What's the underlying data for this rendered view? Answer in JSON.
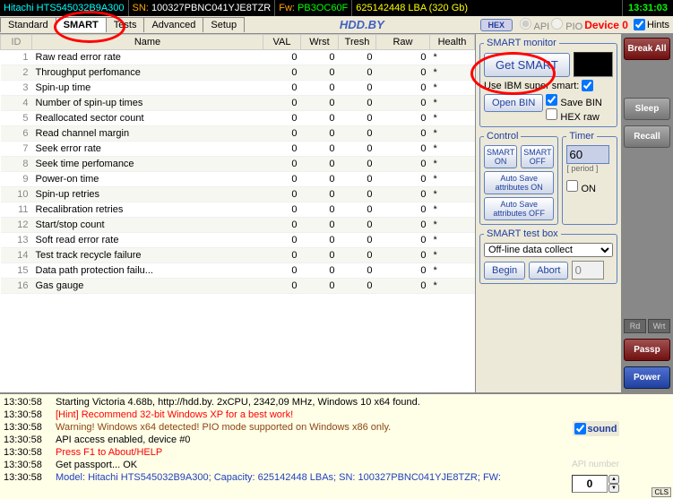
{
  "top": {
    "drive": "Hitachi HTS545032B9A300",
    "sn_label": "SN:",
    "sn_value": "100327PBNC041YJE8TZR",
    "fw_label": "Fw:",
    "fw_value": "PB3OC60F",
    "lba": "625142448 LBA (320 Gb)",
    "clock": "13:31:03"
  },
  "tabs": [
    "Standard",
    "SMART",
    "Tests",
    "Advanced",
    "Setup"
  ],
  "active_tab": "SMART",
  "hddby": "HDD.BY",
  "hex": "HEX",
  "api": "API",
  "pio": "PIO",
  "device": "Device 0",
  "hints": "Hints",
  "table": {
    "headers": [
      "ID",
      "Name",
      "VAL",
      "Wrst",
      "Tresh",
      "Raw",
      "Health"
    ],
    "rows": [
      {
        "id": 1,
        "name": "Raw read error rate",
        "val": 0,
        "wrst": 0,
        "tresh": 0,
        "raw": 0,
        "health": "*"
      },
      {
        "id": 2,
        "name": "Throughput perfomance",
        "val": 0,
        "wrst": 0,
        "tresh": 0,
        "raw": 0,
        "health": "*"
      },
      {
        "id": 3,
        "name": "Spin-up time",
        "val": 0,
        "wrst": 0,
        "tresh": 0,
        "raw": 0,
        "health": "*"
      },
      {
        "id": 4,
        "name": "Number of spin-up times",
        "val": 0,
        "wrst": 0,
        "tresh": 0,
        "raw": 0,
        "health": "*"
      },
      {
        "id": 5,
        "name": "Reallocated sector count",
        "val": 0,
        "wrst": 0,
        "tresh": 0,
        "raw": 0,
        "health": "*"
      },
      {
        "id": 6,
        "name": "Read channel margin",
        "val": 0,
        "wrst": 0,
        "tresh": 0,
        "raw": 0,
        "health": "*"
      },
      {
        "id": 7,
        "name": "Seek error rate",
        "val": 0,
        "wrst": 0,
        "tresh": 0,
        "raw": 0,
        "health": "*"
      },
      {
        "id": 8,
        "name": "Seek time perfomance",
        "val": 0,
        "wrst": 0,
        "tresh": 0,
        "raw": 0,
        "health": "*"
      },
      {
        "id": 9,
        "name": "Power-on time",
        "val": 0,
        "wrst": 0,
        "tresh": 0,
        "raw": 0,
        "health": "*"
      },
      {
        "id": 10,
        "name": "Spin-up retries",
        "val": 0,
        "wrst": 0,
        "tresh": 0,
        "raw": 0,
        "health": "*"
      },
      {
        "id": 11,
        "name": "Recalibration retries",
        "val": 0,
        "wrst": 0,
        "tresh": 0,
        "raw": 0,
        "health": "*"
      },
      {
        "id": 12,
        "name": "Start/stop count",
        "val": 0,
        "wrst": 0,
        "tresh": 0,
        "raw": 0,
        "health": "*"
      },
      {
        "id": 13,
        "name": "Soft read error rate",
        "val": 0,
        "wrst": 0,
        "tresh": 0,
        "raw": 0,
        "health": "*"
      },
      {
        "id": 14,
        "name": "Test track recycle failure",
        "val": 0,
        "wrst": 0,
        "tresh": 0,
        "raw": 0,
        "health": "*"
      },
      {
        "id": 15,
        "name": "Data path protection failu...",
        "val": 0,
        "wrst": 0,
        "tresh": 0,
        "raw": 0,
        "health": "*"
      },
      {
        "id": 16,
        "name": "Gas gauge",
        "val": 0,
        "wrst": 0,
        "tresh": 0,
        "raw": 0,
        "health": "*"
      }
    ]
  },
  "monitor": {
    "legend": "SMART monitor",
    "get_smart": "Get SMART",
    "ibm": "Use IBM super smart:",
    "open_bin": "Open BIN",
    "save_bin": "Save BIN",
    "hex_raw": "HEX raw"
  },
  "control": {
    "legend": "Control",
    "on": "SMART ON",
    "off": "SMART OFF",
    "auto_on": "Auto Save attributes ON",
    "auto_off": "Auto Save attributes OFF"
  },
  "timer": {
    "legend": "Timer",
    "value": "60",
    "period": "[ period ]",
    "on": "ON"
  },
  "testbox": {
    "legend": "SMART test box",
    "selected": "Off-line data collect",
    "begin": "Begin",
    "abort": "Abort",
    "val": "0"
  },
  "side": {
    "break": "Break All",
    "sleep": "Sleep",
    "recall": "Recall",
    "rd": "Rd",
    "wrt": "Wrt",
    "passp": "Passp",
    "power": "Power",
    "sound": "sound",
    "api_label": "API number",
    "api_num": "0"
  },
  "log": [
    {
      "ts": "13:30:58",
      "msg": "Starting Victoria 4.68b, http://hdd.by. 2xCPU, 2342,09 MHz, Windows 10 x64 found.",
      "cls": ""
    },
    {
      "ts": "13:30:58",
      "msg": "[Hint] Recommend 32-bit Windows XP for a best work!",
      "cls": "log-red"
    },
    {
      "ts": "13:30:58",
      "msg": "Warning! Windows x64 detected! PIO mode supported on Windows x86 only.",
      "cls": "log-brown"
    },
    {
      "ts": "13:30:58",
      "msg": "API access enabled, device #0",
      "cls": ""
    },
    {
      "ts": "13:30:58",
      "msg": "Press F1 to About/HELP",
      "cls": "log-red"
    },
    {
      "ts": "13:30:58",
      "msg": "Get passport... OK",
      "cls": ""
    },
    {
      "ts": "13:30:58",
      "msg": "Model: Hitachi HTS545032B9A300; Capacity: 625142448 LBAs; SN: 100327PBNC041YJE8TZR; FW:",
      "cls": "log-blue"
    }
  ],
  "cls": "CLS"
}
